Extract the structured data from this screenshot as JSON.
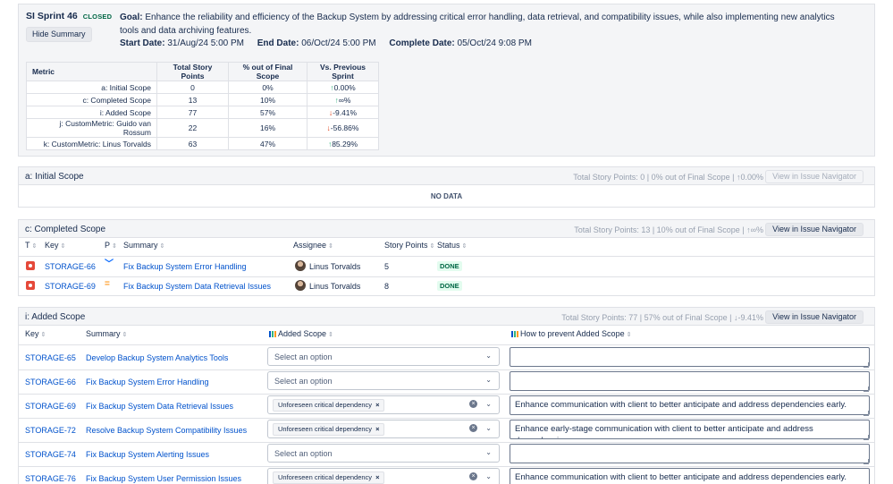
{
  "sprint": {
    "name": "SI Sprint 46",
    "status": "CLOSED",
    "hide_button": "Hide Summary",
    "goal_label": "Goal:",
    "goal_text": "Enhance the reliability and efficiency of the Backup System by addressing critical error handling, data retrieval, and compatibility issues, while also implementing new analytics tools and data archiving features.",
    "start_label": "Start Date:",
    "start_value": "31/Aug/24 5:00 PM",
    "end_label": "End Date:",
    "end_value": "06/Oct/24 5:00 PM",
    "complete_label": "Complete Date:",
    "complete_value": "05/Oct/24 9:08 PM"
  },
  "metrics": {
    "headers": [
      "Metric",
      "Total Story Points",
      "% out of Final Scope",
      "Vs. Previous Sprint"
    ],
    "rows": [
      {
        "metric": "a: Initial Scope",
        "points": "0",
        "pct": "0%",
        "arrow": "↑",
        "vs": "0.00%",
        "trend": "up"
      },
      {
        "metric": "c: Completed Scope",
        "points": "13",
        "pct": "10%",
        "arrow": "↑",
        "vs": "∞%",
        "trend": "up"
      },
      {
        "metric": "i: Added Scope",
        "points": "77",
        "pct": "57%",
        "arrow": "↓",
        "vs": "-9.41%",
        "trend": "down"
      },
      {
        "metric": "j: CustomMetric: Guido van Rossum",
        "points": "22",
        "pct": "16%",
        "arrow": "↓",
        "vs": "-56.86%",
        "trend": "down"
      },
      {
        "metric": "k: CustomMetric: Linus Torvalds",
        "points": "63",
        "pct": "47%",
        "arrow": "↑",
        "vs": "85.29%",
        "trend": "up"
      }
    ]
  },
  "initial_scope": {
    "title": "a: Initial Scope",
    "info": "Total Story Points: 0 | 0% out of Final Scope | ↑0.00%",
    "nav_button": "View in Issue Navigator",
    "empty": "NO DATA"
  },
  "completed_scope": {
    "title": "c: Completed Scope",
    "info": "Total Story Points: 13 | 10% out of Final Scope | ↑∞%",
    "nav_button": "View in Issue Navigator",
    "columns": [
      "T",
      "Key",
      "P",
      "Summary",
      "Assignee",
      "Story Points",
      "Status"
    ],
    "rows": [
      {
        "key": "STORAGE-66",
        "priority": "low",
        "summary": "Fix Backup System Error Handling",
        "assignee": "Linus Torvalds",
        "points": "5",
        "status": "DONE"
      },
      {
        "key": "STORAGE-69",
        "priority": "medium",
        "summary": "Fix Backup System Data Retrieval Issues",
        "assignee": "Linus Torvalds",
        "points": "8",
        "status": "DONE"
      }
    ]
  },
  "added_scope": {
    "title": "i: Added Scope",
    "info": "Total Story Points: 77 | 57% out of Final Scope | ↓-9.41%",
    "nav_button": "View in Issue Navigator",
    "columns": [
      "Key",
      "Summary",
      "Added Scope",
      "How to prevent Added Scope"
    ],
    "select_placeholder": "Select an option",
    "rows": [
      {
        "key": "STORAGE-65",
        "summary": "Develop Backup System Analytics Tools",
        "reason": "",
        "prevent": ""
      },
      {
        "key": "STORAGE-66",
        "summary": "Fix Backup System Error Handling",
        "reason": "",
        "prevent": ""
      },
      {
        "key": "STORAGE-69",
        "summary": "Fix Backup System Data Retrieval Issues",
        "reason": "Unforeseen critical dependency",
        "prevent": "Enhance communication with client to better anticipate and address dependencies early."
      },
      {
        "key": "STORAGE-72",
        "summary": "Resolve Backup System Compatibility Issues",
        "reason": "Unforeseen critical dependency",
        "prevent": "Enhance early-stage communication with client to better anticipate and address dependencies"
      },
      {
        "key": "STORAGE-74",
        "summary": "Fix Backup System Alerting Issues",
        "reason": "",
        "prevent": ""
      },
      {
        "key": "STORAGE-76",
        "summary": "Fix Backup System User Permission Issues",
        "reason": "Unforeseen critical dependency",
        "prevent": "Enhance communication with client to better anticipate and address dependencies early."
      }
    ]
  },
  "icons": {
    "type": "bug-icon",
    "priority_low": "chevron-down-icon",
    "priority_medium": "equals-icon",
    "sort": "sort-icon",
    "clear": "clear-icon",
    "remove": "remove-chip-icon",
    "field": "custom-field-icon",
    "avatar": "avatar"
  },
  "colors": {
    "link": "#0052cc",
    "done": "#006644",
    "up": "#36b37e",
    "down": "#de350b",
    "bug": "#e5493a"
  }
}
